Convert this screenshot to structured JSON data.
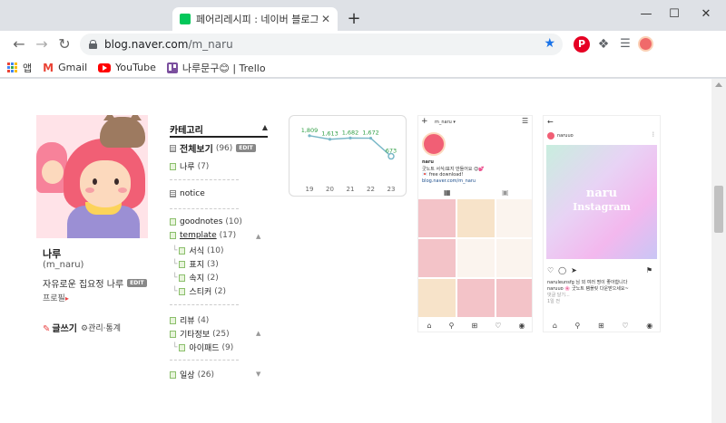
{
  "browser": {
    "tab_title": "페어리레시피 : 네이버 블로그",
    "tab_close": "✕",
    "new_tab": "+",
    "url_host": "blog.naver.com",
    "url_path": "/m_naru",
    "bookmarks": [
      {
        "label": "앱"
      },
      {
        "label": "Gmail"
      },
      {
        "label": "YouTube"
      },
      {
        "label": "나루문구😊 | Trello"
      }
    ],
    "window": {
      "minimize": "—",
      "maximize": "☐",
      "close": "✕"
    }
  },
  "profile": {
    "name": "나루",
    "id": "(m_naru)",
    "description": "자유로운 집요정 나루",
    "edit_badge": "EDIT",
    "profile_link": "프로필",
    "write": "글쓰기",
    "manage": "관리·통계"
  },
  "category": {
    "title": "카테고리",
    "all": {
      "name": "전체보기",
      "count": "(96)",
      "badge": "EDIT"
    },
    "items": [
      {
        "name": "나루",
        "count": "(7)"
      },
      {
        "name": "notice",
        "count": ""
      },
      {
        "name": "goodnotes",
        "count": "(10)"
      },
      {
        "name": "template",
        "count": "(17)"
      },
      {
        "name": "서식",
        "count": "(10)"
      },
      {
        "name": "표지",
        "count": "(3)"
      },
      {
        "name": "속지",
        "count": "(2)"
      },
      {
        "name": "스티커",
        "count": "(2)"
      },
      {
        "name": "리뷰",
        "count": "(4)"
      },
      {
        "name": "기타정보",
        "count": "(25)"
      },
      {
        "name": "아이패드",
        "count": "(9)"
      },
      {
        "name": "일상",
        "count": "(26)"
      }
    ]
  },
  "chart_data": {
    "type": "line",
    "categories": [
      "19",
      "20",
      "21",
      "22",
      "23"
    ],
    "values": [
      1809,
      1613,
      1682,
      1672,
      673
    ],
    "labels": [
      "1,809",
      "1,613",
      "1,682",
      "1,672",
      "673"
    ],
    "ylim": [
      0,
      2000
    ],
    "line_color": "#7ab8c8",
    "label_color": "#2f9e44",
    "grid": false
  },
  "phone1": {
    "username": "m_naru ▾",
    "bio_name": "naru",
    "bio_line1": "굿노트 서식/표지 만들어요 😊💕",
    "bio_line2": "💌 free download!",
    "bio_link": "blog.naver.com/m_naru"
  },
  "phone2": {
    "username": "naruuo",
    "image_title": "naru",
    "image_sub": "Instagram",
    "likes": "naruleunsfg 님 외 여러 명이 좋아합니다",
    "caption": "naruuo 🌸 굿노트 템플릿 다운받으세요~",
    "comments": "댓글 달기...",
    "time": "1일 전"
  },
  "colors": {
    "accent_red": "#e94444",
    "naver_green": "#03c75a",
    "chrome_blue": "#1a73e8"
  }
}
